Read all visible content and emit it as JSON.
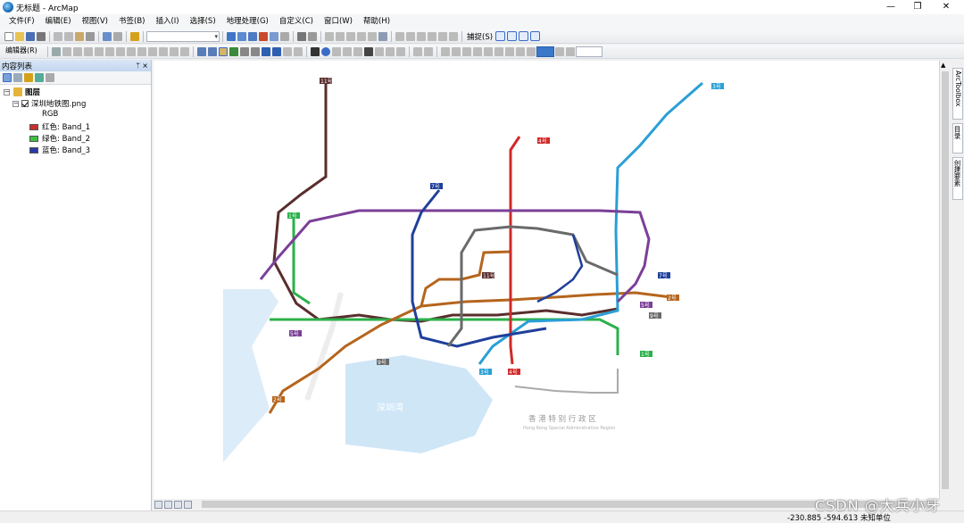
{
  "window": {
    "title": "无标题 - ArcMap",
    "min_glyph": "—",
    "max_glyph": "❐",
    "close_glyph": "✕"
  },
  "menu": [
    "文件(F)",
    "编辑(E)",
    "视图(V)",
    "书签(B)",
    "插入(I)",
    "选择(S)",
    "地理处理(G)",
    "自定义(C)",
    "窗口(W)",
    "帮助(H)"
  ],
  "toolbar": {
    "snapping_label": "捕捉(S)",
    "editor_label": "编辑器(R)"
  },
  "toc": {
    "title": "内容列表",
    "pin_glyph": "ᛘ",
    "close_glyph": "×",
    "root_label": "图层",
    "layer_name": "深圳地铁图.png",
    "rgb_label": "RGB",
    "bands": [
      {
        "label": "红色:   Band_1",
        "color": "#c8312b"
      },
      {
        "label": "绿色: Band_2",
        "color": "#3fbf3f"
      },
      {
        "label": "蓝色:   Band_3",
        "color": "#2b3aa3"
      }
    ]
  },
  "dock_tabs": [
    "ArcToolbox",
    "目录",
    "创建要素"
  ],
  "status": {
    "coords": "-230.885  -594.613 未知单位"
  },
  "watermark": "CSDN @大兵小牙",
  "map": {
    "lines": [
      {
        "name": "1号线",
        "color": "#2bb04a"
      },
      {
        "name": "2号线",
        "color": "#b5651d"
      },
      {
        "name": "3号线",
        "color": "#2a9fd6"
      },
      {
        "name": "4号线",
        "color": "#d12a2a"
      },
      {
        "name": "5号线",
        "color": "#7b3f98"
      },
      {
        "name": "7号线",
        "color": "#1f3f9a"
      },
      {
        "name": "9号线",
        "color": "#8a8a8a"
      },
      {
        "name": "11号线",
        "color": "#5a2d2d"
      }
    ],
    "badges": [
      "11号",
      "4号",
      "3号",
      "7号",
      "5号",
      "1号",
      "2号",
      "9号",
      "11号",
      "2号",
      "1号",
      "9号",
      "5号",
      "7号",
      "2号",
      "3号",
      "4号",
      "5号"
    ],
    "hk_cn": "香 港 特 别 行 政 区",
    "hk_en": "Hong Kong Special Administrative Region",
    "bay_label": "深圳湾"
  }
}
